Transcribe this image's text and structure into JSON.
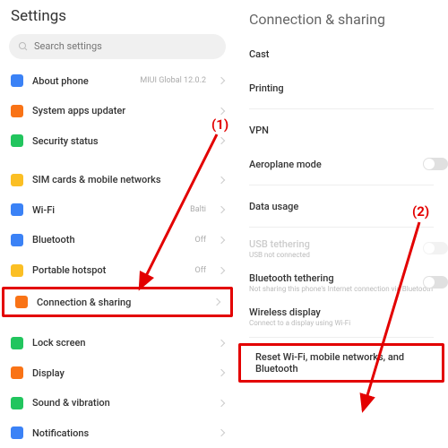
{
  "left": {
    "title": "Settings",
    "search_placeholder": "Search settings",
    "items": [
      {
        "label": "About phone",
        "value": "MIUI Global 12.0.2",
        "color": "#3b82f6"
      },
      {
        "label": "System apps updater",
        "value": "",
        "color": "#f97316"
      },
      {
        "label": "Security status",
        "value": "",
        "color": "#22c55e"
      },
      {
        "label": "SIM cards & mobile networks",
        "value": "",
        "color": "#fbbf24"
      },
      {
        "label": "Wi-Fi",
        "value": "Balti",
        "color": "#3b82f6"
      },
      {
        "label": "Bluetooth",
        "value": "Off",
        "color": "#3b82f6"
      },
      {
        "label": "Portable hotspot",
        "value": "Off",
        "color": "#fbbf24"
      },
      {
        "label": "Connection & sharing",
        "value": "",
        "color": "#f97316"
      },
      {
        "label": "Lock screen",
        "value": "",
        "color": "#22c55e"
      },
      {
        "label": "Display",
        "value": "",
        "color": "#f97316"
      },
      {
        "label": "Sound & vibration",
        "value": "",
        "color": "#22c55e"
      },
      {
        "label": "Notifications",
        "value": "",
        "color": "#3b82f6"
      }
    ]
  },
  "right": {
    "title": "Connection & sharing",
    "items": [
      {
        "label": "Cast",
        "sub": "",
        "toggle": false,
        "disabled": false
      },
      {
        "label": "Printing",
        "sub": "",
        "toggle": false,
        "disabled": false
      },
      {
        "label": "VPN",
        "sub": "",
        "toggle": false,
        "disabled": false
      },
      {
        "label": "Aeroplane mode",
        "sub": "",
        "toggle": true,
        "disabled": false
      },
      {
        "label": "Data usage",
        "sub": "",
        "toggle": false,
        "disabled": false
      },
      {
        "label": "USB tethering",
        "sub": "USB not connected",
        "toggle": true,
        "disabled": true
      },
      {
        "label": "Bluetooth tethering",
        "sub": "Not sharing this phone's Internet connection via Bluetooth",
        "toggle": true,
        "disabled": false
      },
      {
        "label": "Wireless display",
        "sub": "Connect to a display using Wi-Fi",
        "toggle": false,
        "disabled": false
      },
      {
        "label": "Reset Wi-Fi, mobile networks, and Bluetooth",
        "sub": "",
        "toggle": false,
        "disabled": false
      }
    ]
  },
  "annotations": {
    "a1": "(1)",
    "a2": "(2)"
  }
}
